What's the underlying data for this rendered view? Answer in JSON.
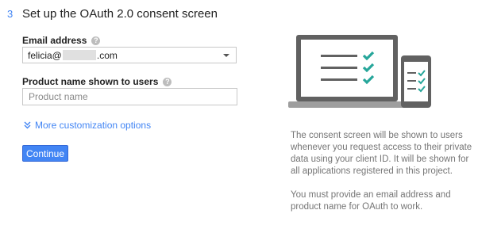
{
  "step": {
    "number": "3",
    "title": "Set up the OAuth 2.0 consent screen"
  },
  "email": {
    "label": "Email address",
    "help_icon": "help-circle-icon",
    "value_prefix": "felicia@",
    "value_suffix": ".com",
    "caret_icon": "dropdown-caret-icon"
  },
  "product": {
    "label": "Product name shown to users",
    "help_icon": "help-circle-icon",
    "placeholder": "Product name",
    "value": ""
  },
  "more_options": {
    "label": "More customization options",
    "icon": "double-chevron-down-icon"
  },
  "continue_label": "Continue",
  "illustration": {
    "laptop_icon": "laptop-checklist-icon",
    "phone_icon": "phone-checklist-icon"
  },
  "description": {
    "p1": "The consent screen will be shown to users whenever you request access to their private data using your client ID. It will be shown for all applications registered in this project.",
    "p2": "You must provide an email address and product name for OAuth to work."
  },
  "colors": {
    "accent": "#4285f4",
    "check": "#26a69a",
    "device": "#616161"
  }
}
